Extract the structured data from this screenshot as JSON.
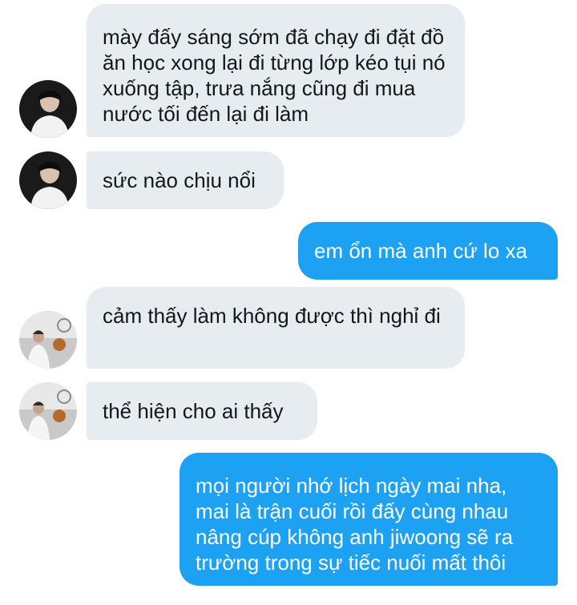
{
  "conversation": {
    "messages": [
      {
        "sender": "other",
        "avatar": "avatar-dark",
        "text": "mày đấy sáng sớm đã chạy đi đặt đồ ăn học xong lại đi từng lớp kéo tụi nó xuống tập, trưa nắng cũng đi mua nước tối đến lại đi làm"
      },
      {
        "sender": "other",
        "avatar": "avatar-dark",
        "text": "sức nào chịu nổi"
      },
      {
        "sender": "me",
        "text": "em ổn mà anh cứ lo xa"
      },
      {
        "sender": "other",
        "avatar": "avatar-gym",
        "text": "cảm thấy làm không được thì nghỉ đi"
      },
      {
        "sender": "other",
        "avatar": "avatar-gym",
        "text": "thể hiện cho ai thấy"
      },
      {
        "sender": "me",
        "text": "mọi người nhớ lịch ngày mai nha, mai là trận cuối rồi đấy cùng nhau nâng cúp không anh jiwoong sẽ ra trường trong sự tiếc nuối mất thôi"
      }
    ]
  },
  "colors": {
    "received_bubble": "#e6ecf0",
    "sent_bubble": "#1da1f2",
    "received_text": "#14171a",
    "sent_text": "#ffffff"
  }
}
